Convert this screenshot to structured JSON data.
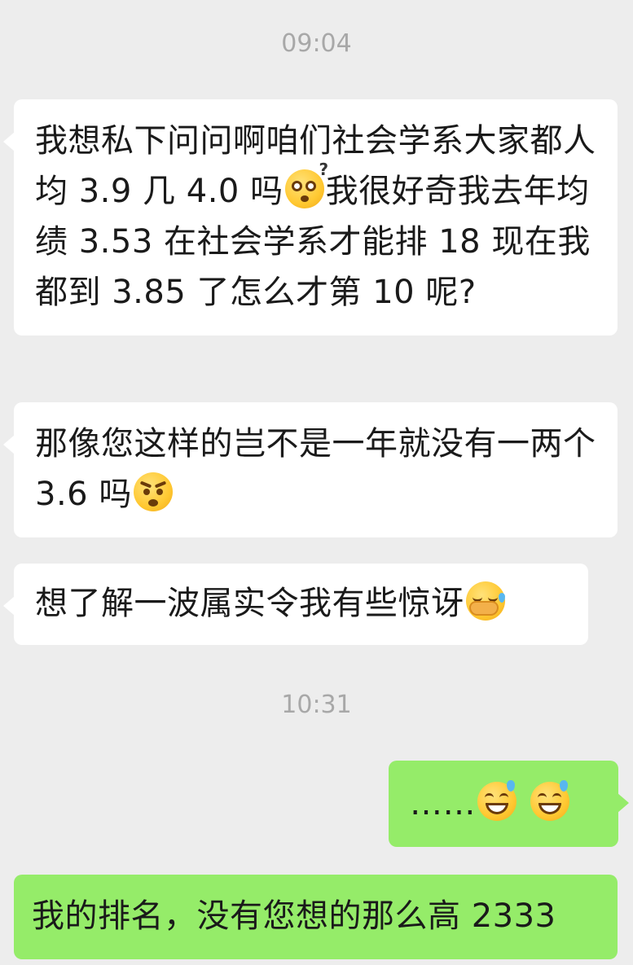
{
  "timestamps": {
    "first": "09:04",
    "second": "10:31"
  },
  "messages": [
    {
      "direction": "incoming",
      "segments": [
        "我想私下问问啊咱们社会学系大家都人均 3.9 几 4.0 吗",
        "我很好奇我去年均绩 3.53 在社会学系才能排 18 现在我都到 3.85 了怎么才第 10 呢?"
      ],
      "emoji": "dizzy-face-icon"
    },
    {
      "direction": "incoming",
      "segments": [
        "那像您这样的岂不是一年就没有一两个 3.6 吗"
      ],
      "emoji": "angry-face-icon"
    },
    {
      "direction": "incoming",
      "segments": [
        "想了解一波属实令我有些惊讶"
      ],
      "emoji": "facepalm-icon"
    },
    {
      "direction": "outgoing",
      "segments": [
        "……"
      ],
      "emoji": "grin-sweat-icon"
    },
    {
      "direction": "outgoing",
      "segments": [
        "我的排名，没有您想的那么高 2333"
      ]
    }
  ],
  "colors": {
    "background": "#ededed",
    "incoming_bubble": "#ffffff",
    "outgoing_bubble": "#95ec69",
    "timestamp": "#a8a8a8"
  }
}
